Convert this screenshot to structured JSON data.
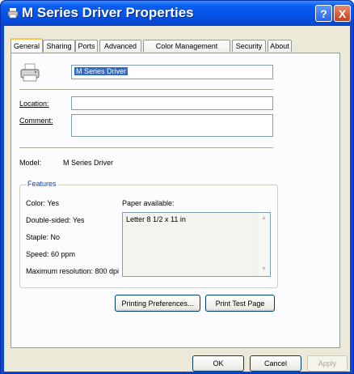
{
  "window": {
    "title": "M Series Driver Properties",
    "help_label": "?",
    "close_label": "X"
  },
  "tabs": [
    "General",
    "Sharing",
    "Ports",
    "Advanced",
    "Color Management",
    "Security",
    "About"
  ],
  "general": {
    "printer_name": "M Series Driver",
    "location_label": "Location:",
    "location_value": "",
    "comment_label": "Comment:",
    "comment_value": "",
    "model_label": "Model:",
    "model_value": "M Series Driver"
  },
  "features": {
    "title": "Features",
    "color": "Color: Yes",
    "double_sided": "Double-sided: Yes",
    "staple": "Staple: No",
    "speed": "Speed: 60 ppm",
    "max_resolution": "Maximum resolution: 800 dpi",
    "paper_label": "Paper available:",
    "paper_items": [
      "Letter 8 1/2 x 11 in"
    ]
  },
  "actions": {
    "printing_preferences": "Printing Preferences...",
    "print_test_page": "Print Test Page"
  },
  "dialog_buttons": {
    "ok": "OK",
    "cancel": "Cancel",
    "apply": "Apply"
  }
}
